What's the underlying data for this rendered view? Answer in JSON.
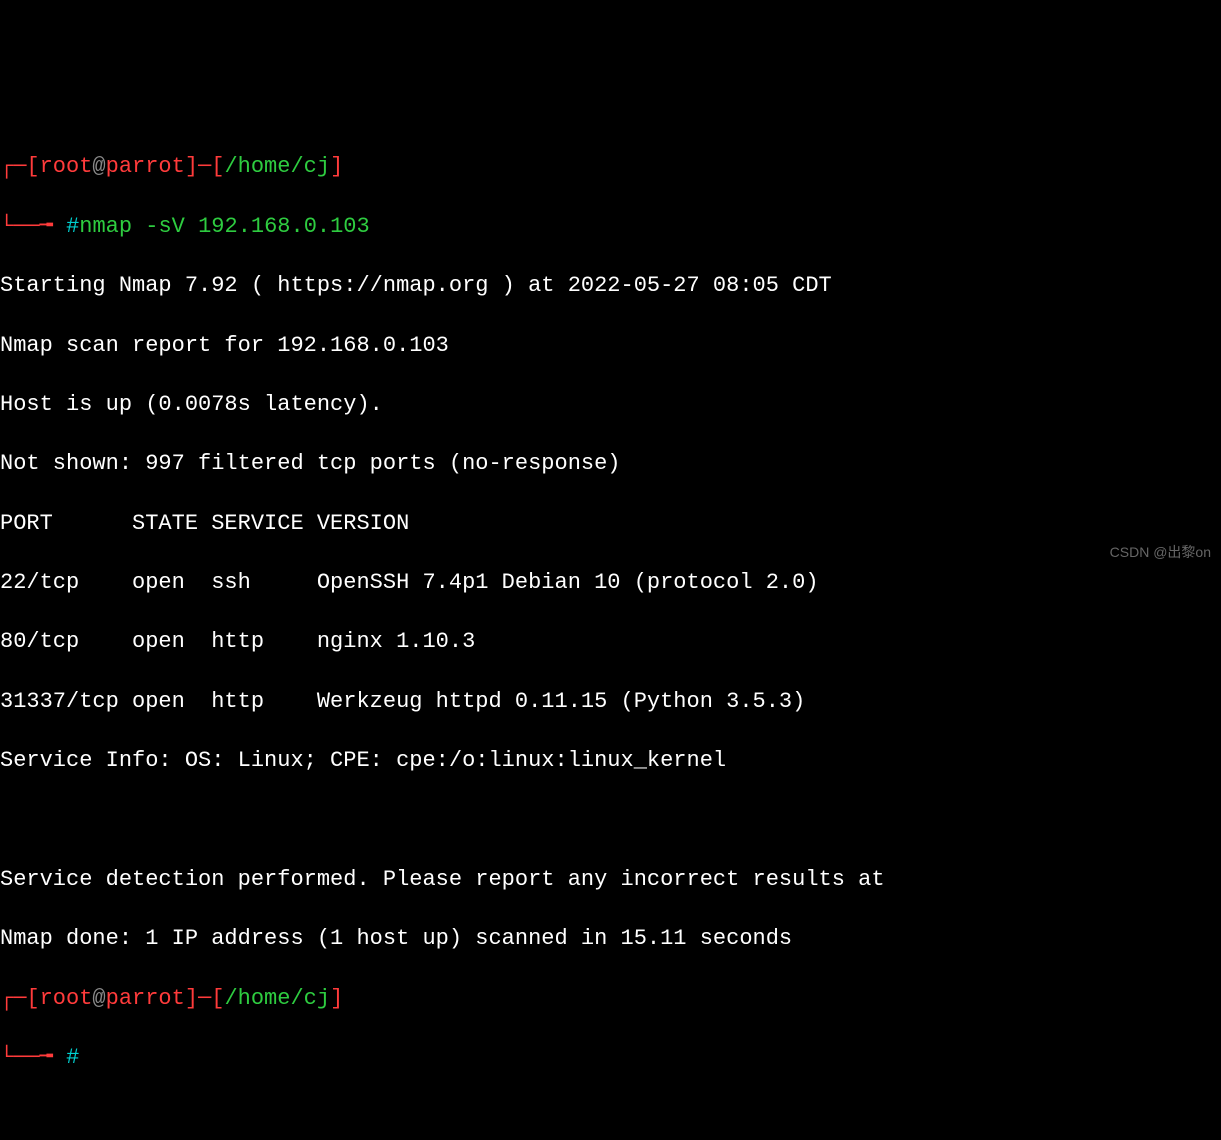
{
  "prompt1": {
    "bracket_open": "┌─[",
    "user": "root",
    "at": "@",
    "host": "parrot",
    "bracket_close1": "]─[",
    "path": "/home/cj",
    "bracket_close2": "]",
    "connector": "└──╼ ",
    "hash": "#",
    "command": "nmap -sV 192.168.0.103"
  },
  "output": {
    "l1": "Starting Nmap 7.92 ( https://nmap.org ) at 2022-05-27 08:05 CDT",
    "l2": "Nmap scan report for 192.168.0.103",
    "l3": "Host is up (0.0078s latency).",
    "l4": "Not shown: 997 filtered tcp ports (no-response)",
    "header": "PORT      STATE SERVICE VERSION",
    "r1": "22/tcp    open  ssh     OpenSSH 7.4p1 Debian 10 (protocol 2.0)",
    "r2": "80/tcp    open  http    nginx 1.10.3",
    "r3": "31337/tcp open  http    Werkzeug httpd 0.11.15 (Python 3.5.3)",
    "sinfo": "Service Info: OS: Linux; CPE: cpe:/o:linux:linux_kernel",
    "blank": " ",
    "det": "Service detection performed. Please report any incorrect results at",
    "done": "Nmap done: 1 IP address (1 host up) scanned in 15.11 seconds"
  },
  "prompt2": {
    "bracket_open": "┌─[",
    "user": "root",
    "at": "@",
    "host": "parrot",
    "bracket_close1": "]─[",
    "path": "/home/cj",
    "bracket_close2": "]",
    "connector": "└──╼ ",
    "hash": "#"
  },
  "watermark": "CSDN @出黎on"
}
